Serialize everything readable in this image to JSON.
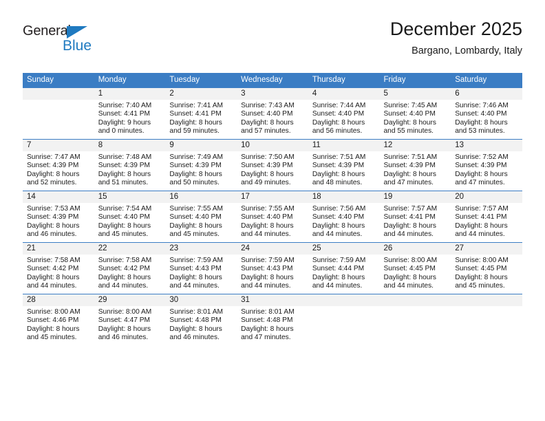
{
  "brand": {
    "name_part1": "General",
    "name_part2": "Blue",
    "accent_color": "#1f7ac0"
  },
  "header": {
    "title": "December 2025",
    "subtitle": "Bargano, Lombardy, Italy"
  },
  "theme": {
    "header_row_color": "#3b7dc4",
    "day_band_color": "#f2f2f2",
    "text_color": "#1a1a1a"
  },
  "weekday_headers": [
    "Sunday",
    "Monday",
    "Tuesday",
    "Wednesday",
    "Thursday",
    "Friday",
    "Saturday"
  ],
  "weeks": [
    [
      {
        "day": "",
        "sunrise": "",
        "sunset": "",
        "daylight_line1": "",
        "daylight_line2": ""
      },
      {
        "day": "1",
        "sunrise": "Sunrise: 7:40 AM",
        "sunset": "Sunset: 4:41 PM",
        "daylight_line1": "Daylight: 9 hours",
        "daylight_line2": "and 0 minutes."
      },
      {
        "day": "2",
        "sunrise": "Sunrise: 7:41 AM",
        "sunset": "Sunset: 4:41 PM",
        "daylight_line1": "Daylight: 8 hours",
        "daylight_line2": "and 59 minutes."
      },
      {
        "day": "3",
        "sunrise": "Sunrise: 7:43 AM",
        "sunset": "Sunset: 4:40 PM",
        "daylight_line1": "Daylight: 8 hours",
        "daylight_line2": "and 57 minutes."
      },
      {
        "day": "4",
        "sunrise": "Sunrise: 7:44 AM",
        "sunset": "Sunset: 4:40 PM",
        "daylight_line1": "Daylight: 8 hours",
        "daylight_line2": "and 56 minutes."
      },
      {
        "day": "5",
        "sunrise": "Sunrise: 7:45 AM",
        "sunset": "Sunset: 4:40 PM",
        "daylight_line1": "Daylight: 8 hours",
        "daylight_line2": "and 55 minutes."
      },
      {
        "day": "6",
        "sunrise": "Sunrise: 7:46 AM",
        "sunset": "Sunset: 4:40 PM",
        "daylight_line1": "Daylight: 8 hours",
        "daylight_line2": "and 53 minutes."
      }
    ],
    [
      {
        "day": "7",
        "sunrise": "Sunrise: 7:47 AM",
        "sunset": "Sunset: 4:39 PM",
        "daylight_line1": "Daylight: 8 hours",
        "daylight_line2": "and 52 minutes."
      },
      {
        "day": "8",
        "sunrise": "Sunrise: 7:48 AM",
        "sunset": "Sunset: 4:39 PM",
        "daylight_line1": "Daylight: 8 hours",
        "daylight_line2": "and 51 minutes."
      },
      {
        "day": "9",
        "sunrise": "Sunrise: 7:49 AM",
        "sunset": "Sunset: 4:39 PM",
        "daylight_line1": "Daylight: 8 hours",
        "daylight_line2": "and 50 minutes."
      },
      {
        "day": "10",
        "sunrise": "Sunrise: 7:50 AM",
        "sunset": "Sunset: 4:39 PM",
        "daylight_line1": "Daylight: 8 hours",
        "daylight_line2": "and 49 minutes."
      },
      {
        "day": "11",
        "sunrise": "Sunrise: 7:51 AM",
        "sunset": "Sunset: 4:39 PM",
        "daylight_line1": "Daylight: 8 hours",
        "daylight_line2": "and 48 minutes."
      },
      {
        "day": "12",
        "sunrise": "Sunrise: 7:51 AM",
        "sunset": "Sunset: 4:39 PM",
        "daylight_line1": "Daylight: 8 hours",
        "daylight_line2": "and 47 minutes."
      },
      {
        "day": "13",
        "sunrise": "Sunrise: 7:52 AM",
        "sunset": "Sunset: 4:39 PM",
        "daylight_line1": "Daylight: 8 hours",
        "daylight_line2": "and 47 minutes."
      }
    ],
    [
      {
        "day": "14",
        "sunrise": "Sunrise: 7:53 AM",
        "sunset": "Sunset: 4:39 PM",
        "daylight_line1": "Daylight: 8 hours",
        "daylight_line2": "and 46 minutes."
      },
      {
        "day": "15",
        "sunrise": "Sunrise: 7:54 AM",
        "sunset": "Sunset: 4:40 PM",
        "daylight_line1": "Daylight: 8 hours",
        "daylight_line2": "and 45 minutes."
      },
      {
        "day": "16",
        "sunrise": "Sunrise: 7:55 AM",
        "sunset": "Sunset: 4:40 PM",
        "daylight_line1": "Daylight: 8 hours",
        "daylight_line2": "and 45 minutes."
      },
      {
        "day": "17",
        "sunrise": "Sunrise: 7:55 AM",
        "sunset": "Sunset: 4:40 PM",
        "daylight_line1": "Daylight: 8 hours",
        "daylight_line2": "and 44 minutes."
      },
      {
        "day": "18",
        "sunrise": "Sunrise: 7:56 AM",
        "sunset": "Sunset: 4:40 PM",
        "daylight_line1": "Daylight: 8 hours",
        "daylight_line2": "and 44 minutes."
      },
      {
        "day": "19",
        "sunrise": "Sunrise: 7:57 AM",
        "sunset": "Sunset: 4:41 PM",
        "daylight_line1": "Daylight: 8 hours",
        "daylight_line2": "and 44 minutes."
      },
      {
        "day": "20",
        "sunrise": "Sunrise: 7:57 AM",
        "sunset": "Sunset: 4:41 PM",
        "daylight_line1": "Daylight: 8 hours",
        "daylight_line2": "and 44 minutes."
      }
    ],
    [
      {
        "day": "21",
        "sunrise": "Sunrise: 7:58 AM",
        "sunset": "Sunset: 4:42 PM",
        "daylight_line1": "Daylight: 8 hours",
        "daylight_line2": "and 44 minutes."
      },
      {
        "day": "22",
        "sunrise": "Sunrise: 7:58 AM",
        "sunset": "Sunset: 4:42 PM",
        "daylight_line1": "Daylight: 8 hours",
        "daylight_line2": "and 44 minutes."
      },
      {
        "day": "23",
        "sunrise": "Sunrise: 7:59 AM",
        "sunset": "Sunset: 4:43 PM",
        "daylight_line1": "Daylight: 8 hours",
        "daylight_line2": "and 44 minutes."
      },
      {
        "day": "24",
        "sunrise": "Sunrise: 7:59 AM",
        "sunset": "Sunset: 4:43 PM",
        "daylight_line1": "Daylight: 8 hours",
        "daylight_line2": "and 44 minutes."
      },
      {
        "day": "25",
        "sunrise": "Sunrise: 7:59 AM",
        "sunset": "Sunset: 4:44 PM",
        "daylight_line1": "Daylight: 8 hours",
        "daylight_line2": "and 44 minutes."
      },
      {
        "day": "26",
        "sunrise": "Sunrise: 8:00 AM",
        "sunset": "Sunset: 4:45 PM",
        "daylight_line1": "Daylight: 8 hours",
        "daylight_line2": "and 44 minutes."
      },
      {
        "day": "27",
        "sunrise": "Sunrise: 8:00 AM",
        "sunset": "Sunset: 4:45 PM",
        "daylight_line1": "Daylight: 8 hours",
        "daylight_line2": "and 45 minutes."
      }
    ],
    [
      {
        "day": "28",
        "sunrise": "Sunrise: 8:00 AM",
        "sunset": "Sunset: 4:46 PM",
        "daylight_line1": "Daylight: 8 hours",
        "daylight_line2": "and 45 minutes."
      },
      {
        "day": "29",
        "sunrise": "Sunrise: 8:00 AM",
        "sunset": "Sunset: 4:47 PM",
        "daylight_line1": "Daylight: 8 hours",
        "daylight_line2": "and 46 minutes."
      },
      {
        "day": "30",
        "sunrise": "Sunrise: 8:01 AM",
        "sunset": "Sunset: 4:48 PM",
        "daylight_line1": "Daylight: 8 hours",
        "daylight_line2": "and 46 minutes."
      },
      {
        "day": "31",
        "sunrise": "Sunrise: 8:01 AM",
        "sunset": "Sunset: 4:48 PM",
        "daylight_line1": "Daylight: 8 hours",
        "daylight_line2": "and 47 minutes."
      },
      {
        "day": "",
        "sunrise": "",
        "sunset": "",
        "daylight_line1": "",
        "daylight_line2": ""
      },
      {
        "day": "",
        "sunrise": "",
        "sunset": "",
        "daylight_line1": "",
        "daylight_line2": ""
      },
      {
        "day": "",
        "sunrise": "",
        "sunset": "",
        "daylight_line1": "",
        "daylight_line2": ""
      }
    ]
  ]
}
